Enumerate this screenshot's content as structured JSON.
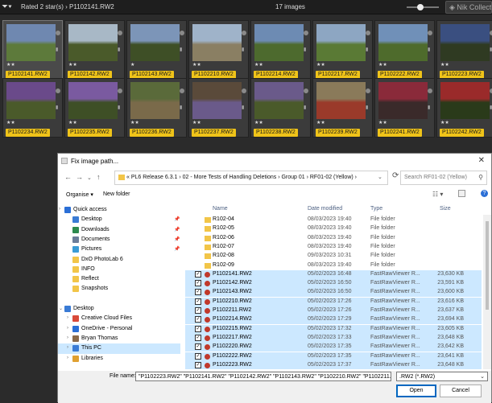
{
  "topbar": {
    "rating_filter": "Rated 2 star(s)",
    "current_file": "P1102141.RW2",
    "image_count": "17 images",
    "nik_label": "Nik Collection"
  },
  "filmstrip": {
    "row1": [
      {
        "label": "P1102141.RW2",
        "stars": "★★",
        "colors": [
          "#6f88b0",
          "#5d7a3b"
        ]
      },
      {
        "label": "P1102142.RW2",
        "stars": "★★",
        "colors": [
          "#a8b8c6",
          "#4a5a2a"
        ]
      },
      {
        "label": "P1102143.RW2",
        "stars": "★",
        "colors": [
          "#7c95b8",
          "#3e4f26"
        ]
      },
      {
        "label": "P1102210.RW2",
        "stars": "★★",
        "colors": [
          "#9fb3c9",
          "#8a7f63"
        ]
      },
      {
        "label": "P1102214.RW2",
        "stars": "★★",
        "colors": [
          "#6d8bb3",
          "#4d6a2e"
        ]
      },
      {
        "label": "P1102217.RW2",
        "stars": "★★",
        "colors": [
          "#8da6c2",
          "#5a7a35"
        ]
      },
      {
        "label": "P1102222.RW2",
        "stars": "★★",
        "colors": [
          "#7090b8",
          "#4e6b2c"
        ]
      },
      {
        "label": "P1102223.RW2",
        "stars": "★★",
        "colors": [
          "#3a4f80",
          "#2f3a22"
        ]
      }
    ],
    "row2": [
      {
        "label": "P1102234.RW2",
        "stars": "★★",
        "colors": [
          "#6a4a8a",
          "#4a5a2a"
        ]
      },
      {
        "label": "P1102235.RW2",
        "stars": "★★",
        "colors": [
          "#7a5aa0",
          "#3e4f26"
        ]
      },
      {
        "label": "P1102236.RW2",
        "stars": "★★",
        "colors": [
          "#5a6a3a",
          "#7a6a4a"
        ]
      },
      {
        "label": "P1102237.RW2",
        "stars": "★★",
        "colors": [
          "#5a4a3a",
          "#6a5a8a"
        ]
      },
      {
        "label": "P1102238.RW2",
        "stars": "★★",
        "colors": [
          "#6a5a8a",
          "#4a5a2a"
        ]
      },
      {
        "label": "P1102239.RW2",
        "stars": "★★",
        "colors": [
          "#8a7a5a",
          "#9a3a2a"
        ]
      },
      {
        "label": "P1102241.RW2",
        "stars": "★★",
        "colors": [
          "#8a2a3a",
          "#3a2a2a"
        ]
      },
      {
        "label": "P1102242.RW2",
        "stars": "★★",
        "colors": [
          "#9a2a2a",
          "#2a3a1a"
        ]
      }
    ]
  },
  "dialog": {
    "title": "Fix image path...",
    "breadcrumb": "«  PL6 Release 6.3.1  ›  02 - More Tests of Handling Deletions  ›  Group 01  ›  RF01-02 (Yellow)  ›",
    "search_placeholder": "Search RF01-02 (Yellow)",
    "organise": "Organise ▾",
    "new_folder": "New folder",
    "columns": {
      "name": "Name",
      "date": "Date modified",
      "type": "Type",
      "size": "Size"
    },
    "nav": [
      {
        "label": "Quick access",
        "icon": "star",
        "indent": 8,
        "chev": "›",
        "pin": false
      },
      {
        "label": "Desktop",
        "icon": "desktop",
        "indent": 18,
        "pin": true
      },
      {
        "label": "Downloads",
        "icon": "download",
        "indent": 18,
        "pin": true
      },
      {
        "label": "Documents",
        "icon": "doc",
        "indent": 18,
        "pin": true
      },
      {
        "label": "Pictures",
        "icon": "pic",
        "indent": 18,
        "pin": true
      },
      {
        "label": "DxO PhotoLab 6",
        "icon": "folder",
        "indent": 18,
        "pin": false
      },
      {
        "label": "INFO",
        "icon": "folder",
        "indent": 18,
        "pin": false
      },
      {
        "label": "Reflect",
        "icon": "folder",
        "indent": 18,
        "pin": false
      },
      {
        "label": "Snapshots",
        "icon": "folder",
        "indent": 18,
        "pin": false
      },
      {
        "label": "",
        "icon": "",
        "indent": 0,
        "pin": false
      },
      {
        "label": "Desktop",
        "icon": "desktop",
        "indent": 8,
        "chev": "⌄",
        "pin": false
      },
      {
        "label": "Creative Cloud Files",
        "icon": "cloud",
        "indent": 18,
        "chev": "›",
        "pin": false
      },
      {
        "label": "OneDrive - Personal",
        "icon": "onedrive",
        "indent": 18,
        "chev": "›",
        "pin": false
      },
      {
        "label": "Bryan Thomas",
        "icon": "user",
        "indent": 18,
        "chev": "›",
        "pin": false
      },
      {
        "label": "This PC",
        "icon": "pc",
        "indent": 18,
        "chev": "›",
        "pin": false,
        "selected": true
      },
      {
        "label": "Libraries",
        "icon": "lib",
        "indent": 18,
        "chev": "›",
        "pin": false
      }
    ],
    "rows": [
      {
        "name": "R102-04",
        "date": "08/03/2023 19:40",
        "type": "File folder",
        "size": "",
        "kind": "folder",
        "selected": false
      },
      {
        "name": "R102-05",
        "date": "08/03/2023 19:40",
        "type": "File folder",
        "size": "",
        "kind": "folder",
        "selected": false
      },
      {
        "name": "R102-06",
        "date": "08/03/2023 19:40",
        "type": "File folder",
        "size": "",
        "kind": "folder",
        "selected": false
      },
      {
        "name": "R102-07",
        "date": "08/03/2023 19:40",
        "type": "File folder",
        "size": "",
        "kind": "folder",
        "selected": false
      },
      {
        "name": "R102-08",
        "date": "09/03/2023 10:31",
        "type": "File folder",
        "size": "",
        "kind": "folder",
        "selected": false
      },
      {
        "name": "R102-09",
        "date": "08/03/2023 19:40",
        "type": "File folder",
        "size": "",
        "kind": "folder",
        "selected": false
      },
      {
        "name": "P1102141.RW2",
        "date": "05/02/2023 16:48",
        "type": "FastRawViewer R...",
        "size": "23,630 KB",
        "kind": "raw",
        "selected": true
      },
      {
        "name": "P1102142.RW2",
        "date": "05/02/2023 16:50",
        "type": "FastRawViewer R...",
        "size": "23,591 KB",
        "kind": "raw",
        "selected": true
      },
      {
        "name": "P1102143.RW2",
        "date": "05/02/2023 16:50",
        "type": "FastRawViewer R...",
        "size": "23,600 KB",
        "kind": "raw",
        "selected": true
      },
      {
        "name": "P1102210.RW2",
        "date": "05/02/2023 17:26",
        "type": "FastRawViewer R...",
        "size": "23,616 KB",
        "kind": "raw",
        "selected": true
      },
      {
        "name": "P1102211.RW2",
        "date": "05/02/2023 17:26",
        "type": "FastRawViewer R...",
        "size": "23,637 KB",
        "kind": "raw",
        "selected": true
      },
      {
        "name": "P1102214.RW2",
        "date": "05/02/2023 17:29",
        "type": "FastRawViewer R...",
        "size": "23,694 KB",
        "kind": "raw",
        "selected": true
      },
      {
        "name": "P1102215.RW2",
        "date": "05/02/2023 17:32",
        "type": "FastRawViewer R...",
        "size": "23,605 KB",
        "kind": "raw",
        "selected": true
      },
      {
        "name": "P1102217.RW2",
        "date": "05/02/2023 17:33",
        "type": "FastRawViewer R...",
        "size": "23,648 KB",
        "kind": "raw",
        "selected": true
      },
      {
        "name": "P1102220.RW2",
        "date": "05/02/2023 17:35",
        "type": "FastRawViewer R...",
        "size": "23,642 KB",
        "kind": "raw",
        "selected": true
      },
      {
        "name": "P1102222.RW2",
        "date": "05/02/2023 17:35",
        "type": "FastRawViewer R...",
        "size": "23,641 KB",
        "kind": "raw",
        "selected": true
      },
      {
        "name": "P1102223.RW2",
        "date": "05/02/2023 17:37",
        "type": "FastRawViewer R...",
        "size": "23,648 KB",
        "kind": "raw",
        "selected": true
      }
    ],
    "file_name_label": "File name:",
    "file_name_value": "\"P1102223.RW2\" \"P1102141.RW2\" \"P1102142.RW2\" \"P1102143.RW2\" \"P1102210.RW2\" \"P1102211.RW2\" \"P110",
    "file_type_value": ".RW2 (*.RW2)",
    "open_label": "Open",
    "cancel_label": "Cancel"
  }
}
